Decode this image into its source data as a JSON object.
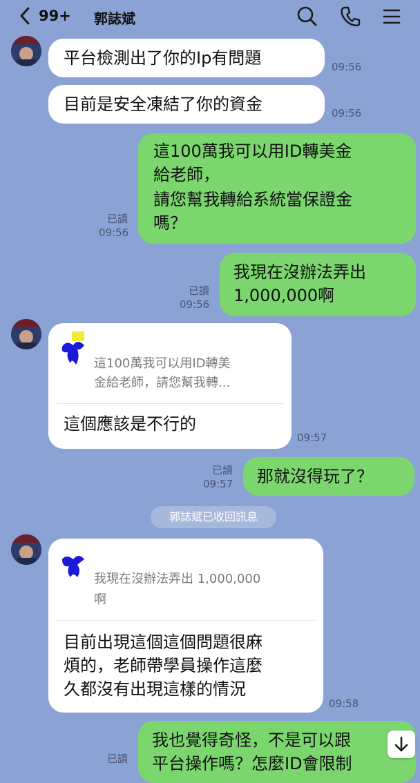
{
  "header": {
    "unread_count": "99+",
    "contact_name": "郭誌斌"
  },
  "messages": [
    {
      "side": "left",
      "text": "平台檢測出了你的Ip有問題",
      "time": "09:56"
    },
    {
      "side": "left",
      "text": "目前是安全凍結了你的資金",
      "time": "09:56"
    },
    {
      "side": "right",
      "lines": [
        "這100萬我可以用ID轉美金",
        "給老師，",
        "請您幫我轉給系統當保證金",
        "嗎？"
      ],
      "read": "已讀",
      "time": "09:56"
    },
    {
      "side": "right",
      "lines": [
        "我現在沒辦法弄出",
        "1,000,000啊"
      ],
      "read": "已讀",
      "time": "09:56"
    },
    {
      "side": "left",
      "quote": [
        "這100萬我可以用ID轉美",
        "金給老師，請您幫我轉..."
      ],
      "text": "這個應該是不行的",
      "time": "09:57"
    },
    {
      "side": "right",
      "text": "那就沒得玩了？",
      "read": "已讀",
      "time": "09:57"
    },
    {
      "side": "left",
      "quote": [
        "我現在沒辦法弄出 1,000,000",
        "啊"
      ],
      "lines": [
        "目前出現這個這個問題很麻",
        "煩的，老師帶學員操作這麼",
        "久都沒有出現這樣的情況"
      ],
      "time": "09:58"
    },
    {
      "side": "right",
      "lines": [
        "我也覺得奇怪，不是可以跟",
        "平台操作嗎？怎麼ID會限制"
      ],
      "read": "已讀"
    }
  ],
  "system_message": "郭誌斌已收回訊息",
  "colors": {
    "background": "#8aa3d4",
    "incoming_bubble": "#ffffff",
    "outgoing_bubble": "#7bd66e"
  }
}
